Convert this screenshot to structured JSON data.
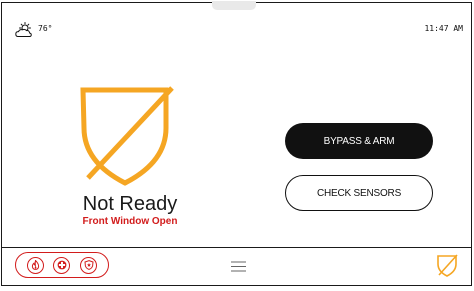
{
  "status_bar": {
    "weather_icon": "cloudy-sun-icon",
    "temperature": "76°",
    "time": "11:47 AM"
  },
  "status": {
    "title": "Not Ready",
    "subtitle": "Front Window Open",
    "icon": "shield-slash-icon"
  },
  "actions": {
    "bypass_arm_label": "BYPASS & ARM",
    "check_sensors_label": "CHECK SENSORS"
  },
  "footer": {
    "panic_icons": [
      "fire-icon",
      "medical-icon",
      "police-icon"
    ],
    "menu_icon": "hamburger-menu-icon",
    "arm_status_icon": "shield-slash-icon"
  },
  "colors": {
    "accent_orange": "#f5a623",
    "alert_red": "#d21c1c",
    "button_dark": "#111111"
  }
}
